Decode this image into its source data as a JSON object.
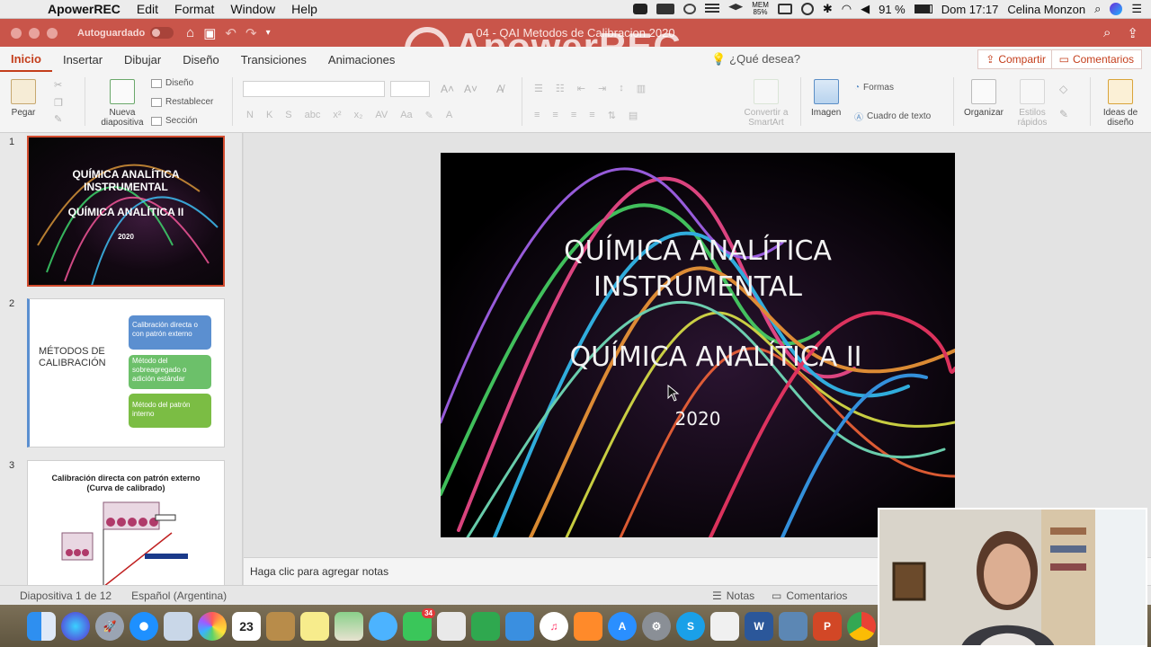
{
  "menubar": {
    "apple": "",
    "app_name": "ApowerREC",
    "menus": [
      "Edit",
      "Format",
      "Window",
      "Help"
    ],
    "mem_label": "MEM",
    "mem_value": "85%",
    "battery": "91 %",
    "clock": "Dom 17:17",
    "user": "Celina Monzon"
  },
  "titlebar": {
    "autosave": "Autoguardado",
    "doc_title": "04 - QAI Metodos de Calibracion 2020"
  },
  "watermark": "ApowerREC",
  "ribbon_tabs": [
    "Inicio",
    "Insertar",
    "Dibujar",
    "Diseño",
    "Transiciones",
    "Animaciones"
  ],
  "tab_search": "¿Qué desea?",
  "share_label": "Compartir",
  "comments_label": "Comentarios",
  "ribbon": {
    "paste": "Pegar",
    "new_slide": "Nueva diapositiva",
    "layout": "Diseño",
    "reset": "Restablecer",
    "section": "Sección",
    "convert_smartart": "Convertir a SmartArt",
    "image": "Imagen",
    "shapes": "Formas",
    "textbox": "Cuadro de texto",
    "arrange": "Organizar",
    "quick_styles": "Estilos rápidos",
    "design_ideas": "Ideas de diseño"
  },
  "thumbnails": [
    {
      "number": "1",
      "line1": "QUÍMICA ANALÍTICA",
      "line2": "INSTRUMENTAL",
      "line3": "QUÍMICA ANALÍTICA II",
      "year": "2020"
    },
    {
      "number": "2",
      "title": "MÉTODOS DE CALIBRACIÓN",
      "box1": "Calibración directa o con patrón externo",
      "box2": "Método del sobreagregado o adición estándar",
      "box3": "Método del patrón interno"
    },
    {
      "number": "3",
      "title": "Calibración directa con patrón externo",
      "subtitle": "(Curva de calibrado)"
    }
  ],
  "slide": {
    "line1": "QUÍMICA ANALÍTICA",
    "line2": "INSTRUMENTAL",
    "line3": "QUÍMICA ANALÍTICA II",
    "year": "2020"
  },
  "notes_placeholder": "Haga clic para agregar notas",
  "status": {
    "slide_count": "Diapositiva 1 de 12",
    "language": "Español (Argentina)",
    "notes": "Notas",
    "comments": "Comentarios"
  },
  "dock_badges": {
    "calendar_day": "23",
    "facetime_badge": "34"
  },
  "colors": {
    "accent": "#c43e1c",
    "titlebar": "#c9554a",
    "box_blue": "#5b8fd0",
    "box_green": "#6cc06a",
    "box_green2": "#7bbd44"
  }
}
